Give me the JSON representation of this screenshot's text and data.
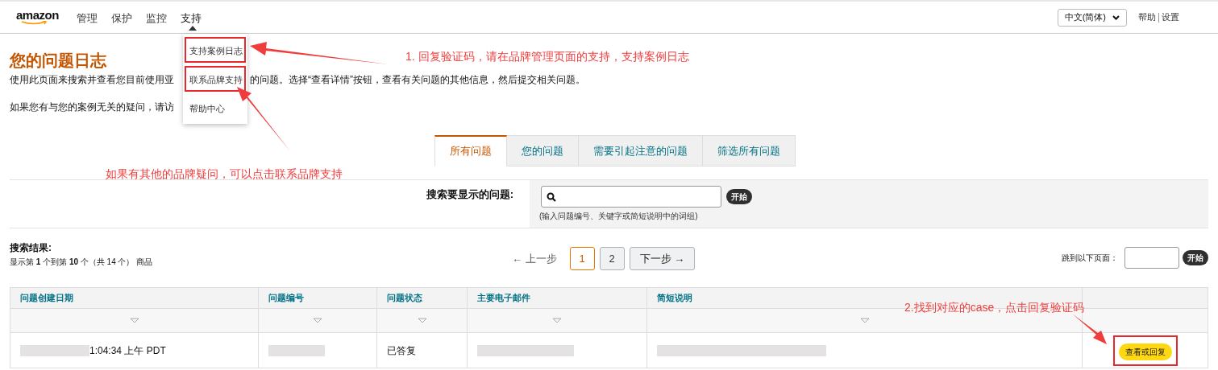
{
  "nav": {
    "logo": "amazon",
    "items": [
      {
        "label": "管理",
        "selected": false
      },
      {
        "label": "保护",
        "selected": false
      },
      {
        "label": "监控",
        "selected": false
      },
      {
        "label": "支持",
        "selected": true
      }
    ],
    "language": "中文(简体)",
    "links": [
      "帮助",
      "设置"
    ]
  },
  "menu": {
    "items": [
      {
        "label": "支持案例日志",
        "annotated": true
      },
      {
        "label": "联系品牌支持",
        "annotated": true
      },
      {
        "label": "帮助中心",
        "annotated": false
      }
    ]
  },
  "page": {
    "title": "您的问题日志",
    "paragraph_start": "使用此页面来搜索并查看您目前使用亚",
    "paragraph_end": "的问题。选择“查看详情”按钮，查看有关问题的其他信息，然后提交相关问题。",
    "note_start": "如果您有与您的案例无关的疑问，请访"
  },
  "tabs": [
    {
      "label": "所有问题",
      "selected": true
    },
    {
      "label": "您的问题",
      "selected": false
    },
    {
      "label": "需要引起注意的问题",
      "selected": false
    },
    {
      "label": "筛选所有问题",
      "selected": false
    }
  ],
  "search": {
    "label": "搜索要显示的问题:",
    "hint": "(输入问题编号、关键字或简短说明中的词组)",
    "button": "开始"
  },
  "results": {
    "heading": "搜索结果:",
    "summary": "显示第 **1** 个到第 **10** 个（共 14 个） 商品"
  },
  "pagination": {
    "prev": "← 上一步",
    "pages": [
      {
        "label": "1",
        "selected": true
      },
      {
        "label": "2",
        "selected": false
      }
    ],
    "next": "下一步 →",
    "jump_label": "跳到以下页面：",
    "jump_button": "开始"
  },
  "table": {
    "columns": [
      "问题创建日期",
      "问题编号",
      "问题状态",
      "主要电子邮件",
      "简短说明"
    ],
    "rows": [
      {
        "cells": [
          {
            "kind": "partial",
            "text": "1:04:34 上午 PDT"
          },
          {
            "kind": "redacted"
          },
          {
            "kind": "text",
            "text": "已答复"
          },
          {
            "kind": "redacted"
          },
          {
            "kind": "redacted"
          },
          {
            "kind": "button",
            "text": "查看或回复",
            "annotated": true
          }
        ]
      }
    ]
  },
  "annotations": [
    {
      "kind": "callout",
      "text": "1. 回复验证码，请在品牌管理页面的支持，支持案例日志"
    },
    {
      "kind": "callout",
      "text": "如果有其他的品牌疑问，可以点击联系品牌支持"
    },
    {
      "kind": "callout",
      "text": "2.找到对应的case，点击回复验证码"
    }
  ]
}
